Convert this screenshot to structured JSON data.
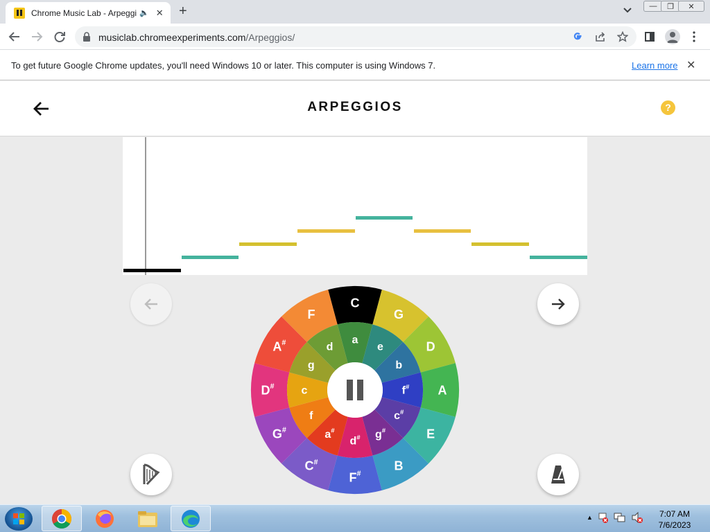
{
  "browser": {
    "tab": {
      "title": "Chrome Music Lab - Arpeggios",
      "audio_icon": "speaker-icon",
      "close_icon": "close-icon"
    },
    "new_tab_label": "+",
    "address": {
      "host": "musiclab.chromeexperiments.com",
      "path": "/Arpeggios/"
    },
    "window_controls": [
      "minimize",
      "restore",
      "close"
    ],
    "toolbar_icons": [
      "back-icon",
      "forward-icon",
      "reload-icon",
      "lock-icon",
      "google-icon",
      "share-icon",
      "star-icon",
      "sidepanel-icon",
      "profile-icon",
      "menu-icon"
    ]
  },
  "infobar": {
    "message": "To get future Google Chrome updates, you'll need Windows 10 or later. This computer is using Windows 7.",
    "link": "Learn more"
  },
  "app": {
    "title": "ARPEGGIOS",
    "help_label": "?",
    "roll": {
      "notes": [
        {
          "step": 0,
          "level": 0,
          "color": "#000000"
        },
        {
          "step": 1,
          "level": 1,
          "color": "#45b39d"
        },
        {
          "step": 2,
          "level": 2,
          "color": "#d4c02f"
        },
        {
          "step": 3,
          "level": 3,
          "color": "#e8c040"
        },
        {
          "step": 4,
          "level": 4,
          "color": "#45b39d"
        },
        {
          "step": 5,
          "level": 3,
          "color": "#e8c040"
        },
        {
          "step": 6,
          "level": 2,
          "color": "#d4c02f"
        },
        {
          "step": 7,
          "level": 1,
          "color": "#45b39d"
        }
      ]
    },
    "wheel": {
      "selected": "C",
      "outer": [
        {
          "label": "C",
          "sharp": false,
          "color": "#000000"
        },
        {
          "label": "G",
          "sharp": false,
          "color": "#d7c22e"
        },
        {
          "label": "D",
          "sharp": false,
          "color": "#9dc535"
        },
        {
          "label": "A",
          "sharp": false,
          "color": "#44b552"
        },
        {
          "label": "E",
          "sharp": false,
          "color": "#3cb4a1"
        },
        {
          "label": "B",
          "sharp": false,
          "color": "#3b9bc4"
        },
        {
          "label": "F",
          "sharp": true,
          "color": "#4e63d6"
        },
        {
          "label": "C",
          "sharp": true,
          "color": "#7b5bc8"
        },
        {
          "label": "G",
          "sharp": true,
          "color": "#9b47bd"
        },
        {
          "label": "D",
          "sharp": true,
          "color": "#e2357e"
        },
        {
          "label": "A",
          "sharp": true,
          "color": "#ee4d3a"
        },
        {
          "label": "F",
          "sharp": false,
          "color": "#f38a35"
        }
      ],
      "inner": [
        {
          "label": "a",
          "sharp": false,
          "color": "#3f8c3e"
        },
        {
          "label": "e",
          "sharp": false,
          "color": "#2e8a7e"
        },
        {
          "label": "b",
          "sharp": false,
          "color": "#2e73a0"
        },
        {
          "label": "f",
          "sharp": true,
          "color": "#2f3fc4"
        },
        {
          "label": "c",
          "sharp": true,
          "color": "#5b3ea6"
        },
        {
          "label": "g",
          "sharp": true,
          "color": "#7a2f93"
        },
        {
          "label": "d",
          "sharp": true,
          "color": "#d8236c"
        },
        {
          "label": "a",
          "sharp": true,
          "color": "#e33b1f"
        },
        {
          "label": "f",
          "sharp": false,
          "color": "#ef7d14"
        },
        {
          "label": "c",
          "sharp": false,
          "color": "#e6a411"
        },
        {
          "label": "g",
          "sharp": false,
          "color": "#9aa02b"
        },
        {
          "label": "d",
          "sharp": false,
          "color": "#6d9c35"
        }
      ],
      "center_icon": "pause-icon"
    },
    "controls": {
      "prev_icon": "arrow-left-icon",
      "next_icon": "arrow-right-icon",
      "instrument_icon": "harp-icon",
      "tempo_icon": "metronome-icon"
    }
  },
  "taskbar": {
    "apps": [
      "chrome-icon",
      "firefox-icon",
      "file-explorer-icon",
      "edge-icon"
    ],
    "time": "7:07 AM",
    "date": "7/6/2023"
  }
}
